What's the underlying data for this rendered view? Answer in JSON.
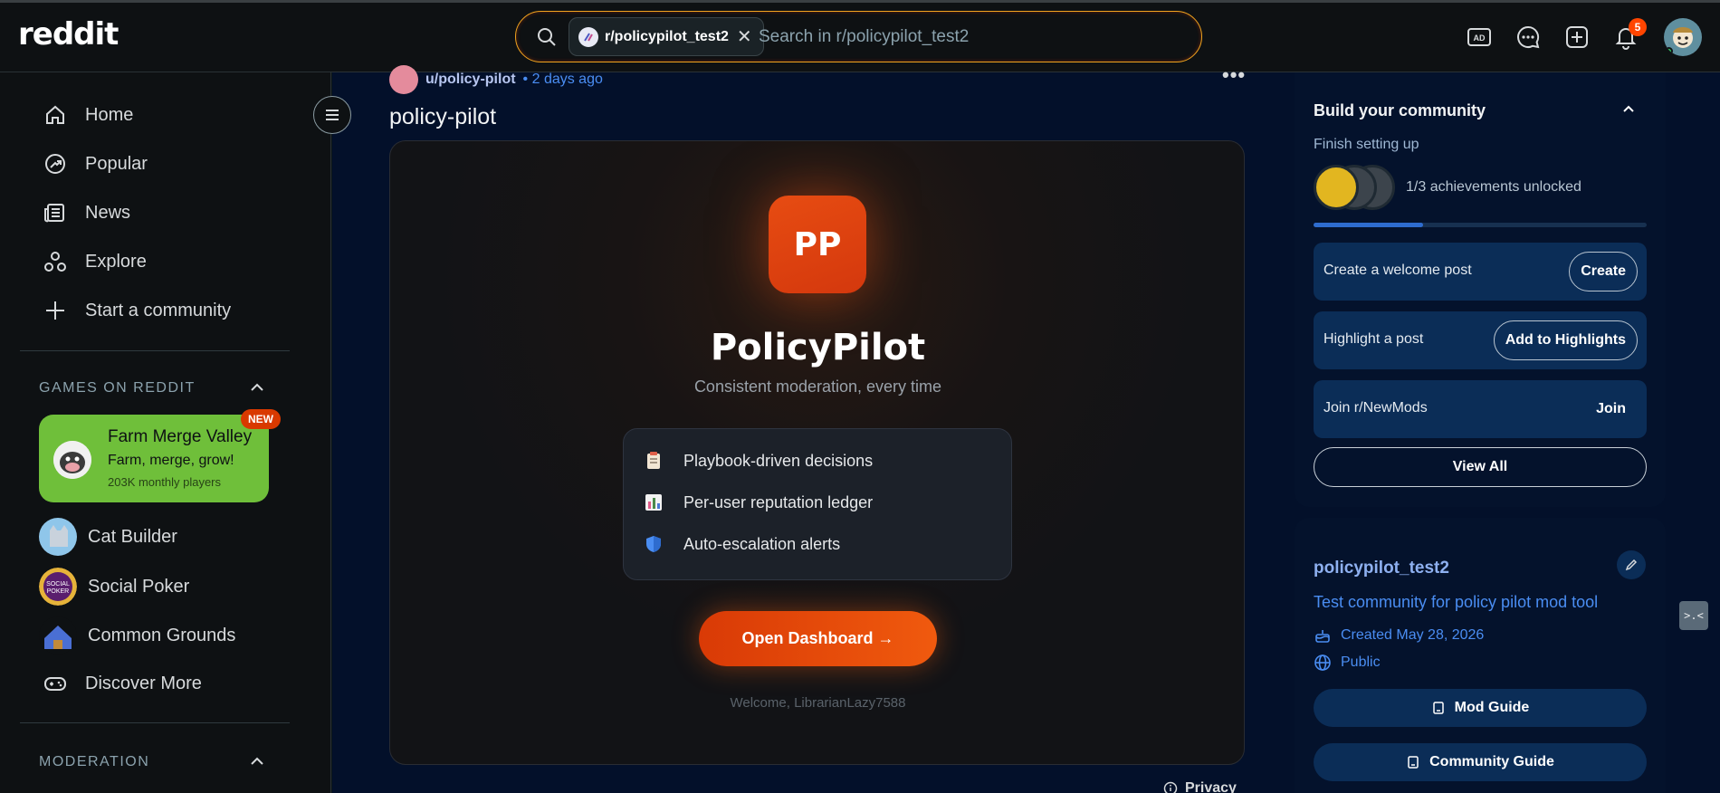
{
  "header": {
    "logo": "reddit",
    "search_chip": "r/policypilot_test2",
    "search_placeholder": "Search in r/policypilot_test2",
    "notification_count": "5",
    "icons": [
      "ads-icon",
      "chat-icon",
      "create-post-icon",
      "notification-bell-icon",
      "user-avatar"
    ]
  },
  "sidebar": {
    "nav": [
      {
        "label": "Home",
        "icon": "home-icon"
      },
      {
        "label": "Popular",
        "icon": "popular-icon"
      },
      {
        "label": "News",
        "icon": "news-icon"
      },
      {
        "label": "Explore",
        "icon": "explore-icon"
      },
      {
        "label": "Start a community",
        "icon": "plus-icon"
      }
    ],
    "games_section": "GAMES ON REDDIT",
    "featured_game": {
      "title": "Farm Merge Valley",
      "subtitle": "Farm, merge, grow!",
      "players": "203K monthly players",
      "badge": "NEW"
    },
    "games": [
      "Cat Builder",
      "Social Poker",
      "Common Grounds"
    ],
    "discover": "Discover More",
    "moderation_section": "MODERATION"
  },
  "post": {
    "author": "u/policy-pilot",
    "time": "• 2 days ago",
    "title": "policy-pilot",
    "app": {
      "logo": "PP",
      "name": "PolicyPilot",
      "tagline": "Consistent moderation, every time",
      "features": [
        "Playbook-driven decisions",
        "Per-user reputation ledger",
        "Auto-escalation alerts"
      ],
      "button": "Open Dashboard →",
      "welcome": "Welcome, LibrarianLazy7588"
    },
    "privacy": "Privacy"
  },
  "build_community": {
    "title": "Build your community",
    "subtitle": "Finish setting up",
    "achievements": "1/3 achievements unlocked",
    "progress": 0.33,
    "tasks": [
      {
        "label": "Create a welcome post",
        "button": "Create"
      },
      {
        "label": "Highlight a post",
        "button": "Add to Highlights"
      },
      {
        "label": "Join r/NewMods",
        "button": "Join"
      }
    ],
    "view_all": "View All"
  },
  "community": {
    "name": "policypilot_test2",
    "description": "Test community for policy pilot mod tool",
    "created": "Created May 28, 2026",
    "visibility": "Public",
    "mod_guide": "Mod Guide",
    "community_guide": "Community Guide"
  },
  "colors": {
    "accent": "#ff4500",
    "link": "#4a8df2",
    "main_bg": "#03102a"
  }
}
